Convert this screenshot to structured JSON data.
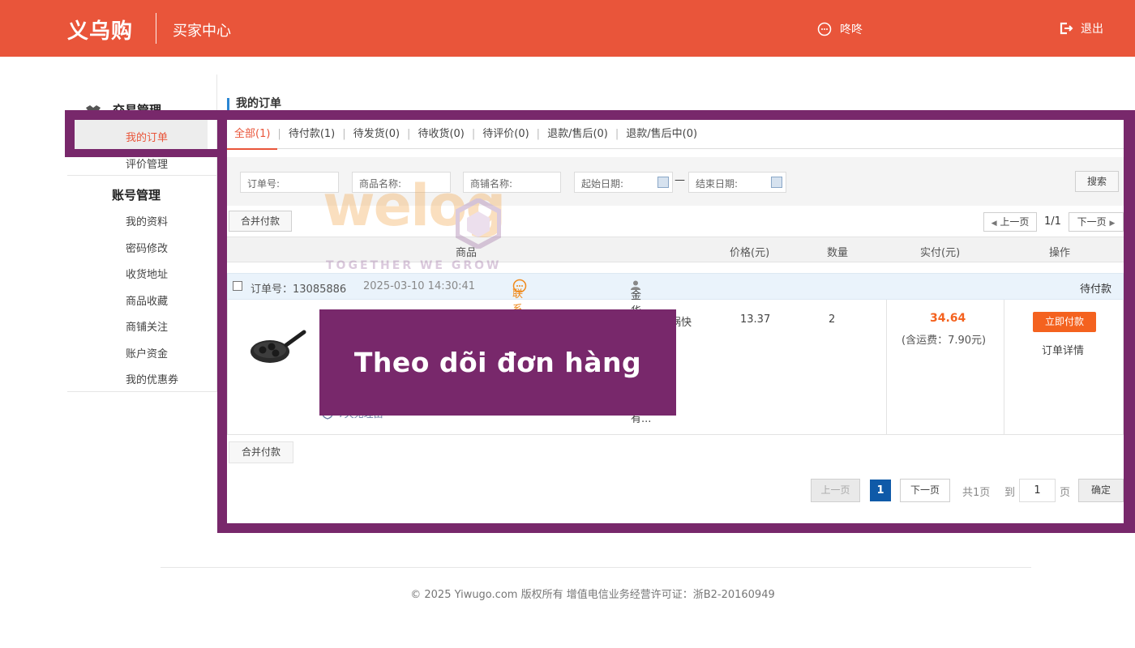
{
  "header": {
    "logo": "义乌购",
    "center": "买家中心",
    "username": "咚咚",
    "logout": "退出"
  },
  "sidebar": {
    "groups": [
      {
        "title": "交易管理",
        "items": [
          "我的订单",
          "评价管理"
        ]
      },
      {
        "title": "账号管理",
        "items": [
          "我的资料",
          "密码修改",
          "收货地址",
          "商品收藏",
          "商铺关注",
          "账户资金",
          "我的优惠券"
        ]
      }
    ],
    "active": "我的订单"
  },
  "main": {
    "title": "我的订单",
    "tabs": [
      "全部(1)",
      "待付款(1)",
      "待发货(0)",
      "待收货(0)",
      "待评价(0)",
      "退款/售后(0)",
      "退款/售后中(0)"
    ],
    "filters": {
      "order_no": "订单号:",
      "product_name": "商品名称:",
      "shop_name": "商铺名称:",
      "start_date": "起始日期:",
      "dash": "—",
      "end_date": "结束日期:",
      "search": "搜索"
    },
    "merge_pay": "合并付款",
    "pager_top": {
      "prev": "上一页",
      "page": "1/1",
      "next": "下一页"
    },
    "columns": {
      "product": "商品",
      "price": "价格(元)",
      "qty": "数量",
      "paid": "实付(元)",
      "action": "操作"
    },
    "order": {
      "order_no": "订单号：13085886",
      "time": "2025-03-10 14:30:41",
      "contact": "联系卖家",
      "shop": "金华市家居日用品有...",
      "status": "待付款",
      "product_tail": "锅快",
      "price": "13.37",
      "qty": "2",
      "total": "34.64",
      "shipping": "(含运费：7.90元)",
      "pay_btn": "立即付款",
      "detail": "订单详情",
      "service_hint": "7天无理由"
    },
    "pager_bottom": {
      "prev": "上一页",
      "current": "1",
      "next": "下一页",
      "total": "共1页",
      "goto": "到",
      "goto_value": "1",
      "page_unit": "页",
      "confirm": "确定"
    }
  },
  "overlay": {
    "text": "Theo dõi đơn hàng"
  },
  "watermark": {
    "brand": "welog",
    "tagline": "TOGETHER WE GROW"
  },
  "footer": {
    "text": "© 2025 Yiwugo.com 版权所有 增值电信业务经营许可证：浙B2-20160949"
  },
  "colors": {
    "header": "#e9553a",
    "accent": "#e9553a",
    "frame": "#78286b",
    "pay_button": "#f4621f",
    "page_active": "#0f5aa8"
  }
}
